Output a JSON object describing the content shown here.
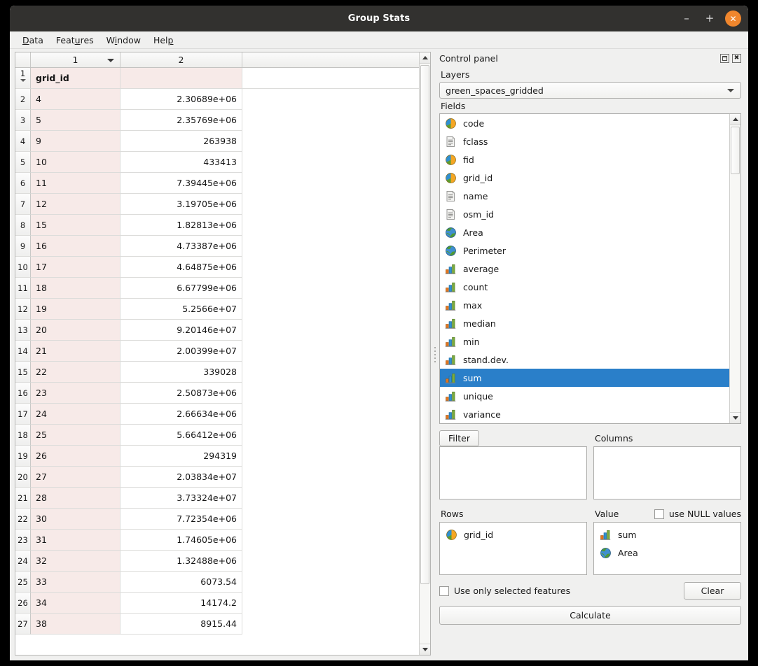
{
  "window": {
    "title": "Group Stats",
    "controls": {
      "minimize": "–",
      "maximize": "+",
      "close": "✕"
    }
  },
  "menubar": {
    "items": [
      {
        "label": "Data",
        "mnemonic_index": 0
      },
      {
        "label": "Features",
        "mnemonic_index": 4
      },
      {
        "label": "Window",
        "mnemonic_index": 1
      },
      {
        "label": "Help",
        "mnemonic_index": 3
      }
    ]
  },
  "table": {
    "column_headers": [
      "1",
      "2"
    ],
    "header_row": {
      "number": "1",
      "col1": "grid_id",
      "col2": ""
    },
    "rows": [
      {
        "n": "2",
        "col1": "4",
        "col2": "2.30689e+06"
      },
      {
        "n": "3",
        "col1": "5",
        "col2": "2.35769e+06"
      },
      {
        "n": "4",
        "col1": "9",
        "col2": "263938"
      },
      {
        "n": "5",
        "col1": "10",
        "col2": "433413"
      },
      {
        "n": "6",
        "col1": "11",
        "col2": "7.39445e+06"
      },
      {
        "n": "7",
        "col1": "12",
        "col2": "3.19705e+06"
      },
      {
        "n": "8",
        "col1": "15",
        "col2": "1.82813e+06"
      },
      {
        "n": "9",
        "col1": "16",
        "col2": "4.73387e+06"
      },
      {
        "n": "10",
        "col1": "17",
        "col2": "4.64875e+06"
      },
      {
        "n": "11",
        "col1": "18",
        "col2": "6.67799e+06"
      },
      {
        "n": "12",
        "col1": "19",
        "col2": "5.2566e+07"
      },
      {
        "n": "13",
        "col1": "20",
        "col2": "9.20146e+07"
      },
      {
        "n": "14",
        "col1": "21",
        "col2": "2.00399e+07"
      },
      {
        "n": "15",
        "col1": "22",
        "col2": "339028"
      },
      {
        "n": "16",
        "col1": "23",
        "col2": "2.50873e+06"
      },
      {
        "n": "17",
        "col1": "24",
        "col2": "2.66634e+06"
      },
      {
        "n": "18",
        "col1": "25",
        "col2": "5.66412e+06"
      },
      {
        "n": "19",
        "col1": "26",
        "col2": "294319"
      },
      {
        "n": "20",
        "col1": "27",
        "col2": "2.03834e+07"
      },
      {
        "n": "21",
        "col1": "28",
        "col2": "3.73324e+07"
      },
      {
        "n": "22",
        "col1": "30",
        "col2": "7.72354e+06"
      },
      {
        "n": "23",
        "col1": "31",
        "col2": "1.74605e+06"
      },
      {
        "n": "24",
        "col1": "32",
        "col2": "1.32488e+06"
      },
      {
        "n": "25",
        "col1": "33",
        "col2": "6073.54"
      },
      {
        "n": "26",
        "col1": "34",
        "col2": "14174.2"
      },
      {
        "n": "27",
        "col1": "38",
        "col2": "8915.44"
      }
    ]
  },
  "control_panel": {
    "title": "Control panel",
    "dock_icons": {
      "float": "float-icon",
      "close": "close-icon"
    },
    "layers": {
      "label": "Layers",
      "selected": "green_spaces_gridded"
    },
    "fields": {
      "label": "Fields",
      "items": [
        {
          "label": "code",
          "icon": "numeric-field-icon",
          "selected": false
        },
        {
          "label": "fclass",
          "icon": "text-field-icon",
          "selected": false
        },
        {
          "label": "fid",
          "icon": "numeric-field-icon",
          "selected": false
        },
        {
          "label": "grid_id",
          "icon": "numeric-field-icon",
          "selected": false
        },
        {
          "label": "name",
          "icon": "text-field-icon",
          "selected": false
        },
        {
          "label": "osm_id",
          "icon": "text-field-icon",
          "selected": false
        },
        {
          "label": "Area",
          "icon": "geometry-field-icon",
          "selected": false
        },
        {
          "label": "Perimeter",
          "icon": "geometry-field-icon",
          "selected": false
        },
        {
          "label": "average",
          "icon": "statistic-icon",
          "selected": false
        },
        {
          "label": "count",
          "icon": "statistic-icon",
          "selected": false
        },
        {
          "label": "max",
          "icon": "statistic-icon",
          "selected": false
        },
        {
          "label": "median",
          "icon": "statistic-icon",
          "selected": false
        },
        {
          "label": "min",
          "icon": "statistic-icon",
          "selected": false
        },
        {
          "label": "stand.dev.",
          "icon": "statistic-icon",
          "selected": false
        },
        {
          "label": "sum",
          "icon": "statistic-icon",
          "selected": true
        },
        {
          "label": "unique",
          "icon": "statistic-icon",
          "selected": false
        },
        {
          "label": "variance",
          "icon": "statistic-icon",
          "selected": false
        }
      ]
    },
    "filter": {
      "button_label": "Filter",
      "items": []
    },
    "columns": {
      "label": "Columns",
      "items": []
    },
    "rows": {
      "label": "Rows",
      "items": [
        {
          "label": "grid_id",
          "icon": "numeric-field-icon"
        }
      ]
    },
    "value": {
      "label": "Value",
      "items": [
        {
          "label": "sum",
          "icon": "statistic-icon"
        },
        {
          "label": "Area",
          "icon": "geometry-field-icon"
        }
      ]
    },
    "use_null_values": {
      "label": "use NULL values",
      "checked": false
    },
    "use_only_selected": {
      "label": "Use only selected features",
      "checked": false
    },
    "clear_button": "Clear",
    "calculate_button": "Calculate"
  },
  "colors": {
    "titlebar": "#32312f",
    "close_button": "#f0862d",
    "selection": "#2a7fc9",
    "key_column": "#f7eae8",
    "panel_bg": "#f0f0ef"
  }
}
